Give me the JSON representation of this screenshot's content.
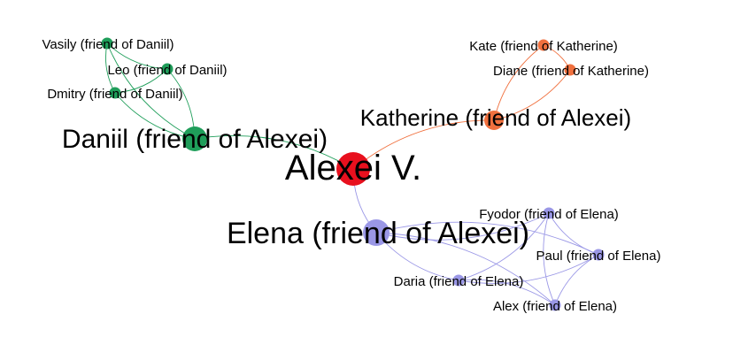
{
  "graph": {
    "center": {
      "id": "alexei",
      "label": "Alexei V.",
      "color": "#e8101e"
    },
    "groups": [
      {
        "id": "daniil",
        "color": "#1f9e5a",
        "hub": {
          "id": "daniil",
          "label": "Daniil (friend of Alexei)"
        },
        "members": [
          {
            "id": "vasily",
            "label": "Vasily (friend of Daniil)"
          },
          {
            "id": "leo",
            "label": "Leo (friend of Daniil)"
          },
          {
            "id": "dmitry",
            "label": "Dmitry (friend of Daniil)"
          }
        ]
      },
      {
        "id": "katherine",
        "color": "#f0703e",
        "hub": {
          "id": "katherine",
          "label": "Katherine (friend of Alexei)"
        },
        "members": [
          {
            "id": "kate",
            "label": "Kate (friend of Katherine)"
          },
          {
            "id": "diane",
            "label": "Diane (friend of Katherine)"
          }
        ]
      },
      {
        "id": "elena",
        "color": "#9a97e6",
        "hub": {
          "id": "elena",
          "label": "Elena (friend of Alexei)"
        },
        "members": [
          {
            "id": "fyodor",
            "label": "Fyodor (friend of Elena)"
          },
          {
            "id": "paul",
            "label": "Paul (friend of Elena)"
          },
          {
            "id": "daria",
            "label": "Daria (friend of Elena)"
          },
          {
            "id": "alex",
            "label": "Alex (friend of Elena)"
          }
        ]
      }
    ],
    "edges": [
      {
        "from": "alexei",
        "to": "daniil"
      },
      {
        "from": "alexei",
        "to": "katherine"
      },
      {
        "from": "alexei",
        "to": "elena"
      },
      {
        "from": "daniil",
        "to": "vasily"
      },
      {
        "from": "daniil",
        "to": "leo"
      },
      {
        "from": "daniil",
        "to": "dmitry"
      },
      {
        "from": "vasily",
        "to": "leo"
      },
      {
        "from": "leo",
        "to": "dmitry"
      },
      {
        "from": "vasily",
        "to": "dmitry"
      },
      {
        "from": "katherine",
        "to": "kate"
      },
      {
        "from": "katherine",
        "to": "diane"
      },
      {
        "from": "kate",
        "to": "diane"
      },
      {
        "from": "elena",
        "to": "fyodor"
      },
      {
        "from": "elena",
        "to": "paul"
      },
      {
        "from": "elena",
        "to": "daria"
      },
      {
        "from": "elena",
        "to": "alex"
      },
      {
        "from": "fyodor",
        "to": "paul"
      },
      {
        "from": "fyodor",
        "to": "daria"
      },
      {
        "from": "fyodor",
        "to": "alex"
      },
      {
        "from": "paul",
        "to": "daria"
      },
      {
        "from": "paul",
        "to": "alex"
      },
      {
        "from": "daria",
        "to": "alex"
      }
    ]
  }
}
